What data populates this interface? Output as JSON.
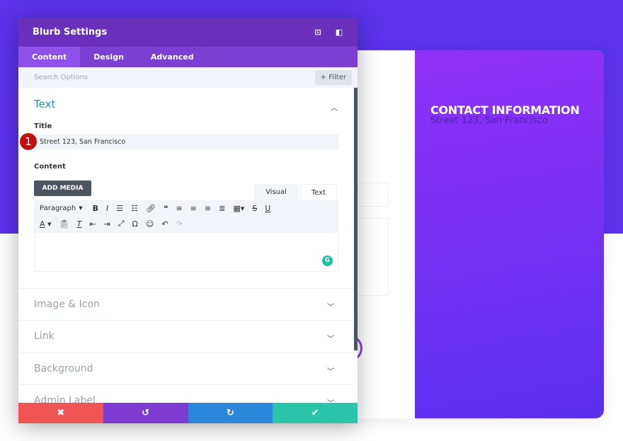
{
  "modal": {
    "title": "Blurb Settings",
    "tabs": [
      "Content",
      "Design",
      "Advanced"
    ],
    "search_placeholder": "Search Options",
    "filter_label": "+ Filter",
    "text_section": {
      "title": "Text",
      "title_label": "Title",
      "title_value": "Street 123, San Francisco",
      "step_badge": "1",
      "content_label": "Content",
      "add_media": "ADD MEDIA",
      "visual_tab": "Visual",
      "text_tab": "Text",
      "paragraph_select": "Paragraph"
    },
    "sections": [
      "Image & Icon",
      "Link",
      "Background",
      "Admin Label"
    ],
    "footer_colors": {
      "cancel": "#ef5555",
      "undo": "#7e3bd0",
      "redo": "#2b87da",
      "save": "#29c4a9"
    }
  },
  "preview": {
    "heading": "CONTACT INFORMATION",
    "subtext": "Street 123, San Francisco"
  },
  "colors": {
    "background_purple": "#5a33ea",
    "header": "#6a2fbb",
    "tabs": "#7b3fd2"
  }
}
